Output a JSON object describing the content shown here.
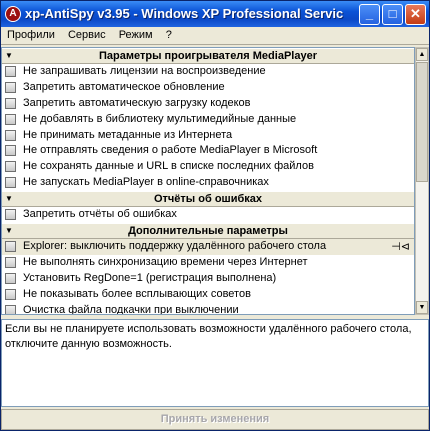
{
  "window": {
    "title": "xp-AntiSpy v3.95 - Windows XP Professional Servic",
    "icon_glyph": "A",
    "controls": {
      "minimize": "_",
      "maximize": "□",
      "close": "✕"
    }
  },
  "menu": [
    "Профили",
    "Сервис",
    "Режим",
    "?"
  ],
  "sections": [
    {
      "title": "Параметры проигрывателя MediaPlayer",
      "items": [
        "Не запрашивать лицензии на воспроизведение",
        "Запретить автоматическое обновление",
        "Запретить автоматическую загрузку кодеков",
        "Не добавлять в библиотеку мультимедийные данные",
        "Не принимать метаданные из Интернета",
        "Не отправлять сведения о работе MediaPlayer в Microsoft",
        "Не сохранять данные и URL в списке последних файлов",
        "Не запускать MediaPlayer в online-справочниках"
      ]
    },
    {
      "title": "Отчёты об ошибках",
      "items": [
        "Запретить отчёты об ошибках"
      ]
    },
    {
      "title": "Дополнительные параметры",
      "items": [
        "Explorer: выключить поддержку удалённого рабочего стола",
        "Не выполнять синхронизацию времени через Интернет",
        "Установить RegDone=1 (регистрация выполнена)",
        "Не показывать более всплывающих советов",
        "Очистка файла подкачки при выключении"
      ]
    }
  ],
  "description": "Если вы не планируете использовать возможности удалённого рабочего стола, отключите данную возможность.",
  "apply_button": "Принять изменения",
  "icons": {
    "section_arrow": "▼",
    "pin": "⊣⊲",
    "scroll_up": "▲",
    "scroll_down": "▼"
  }
}
